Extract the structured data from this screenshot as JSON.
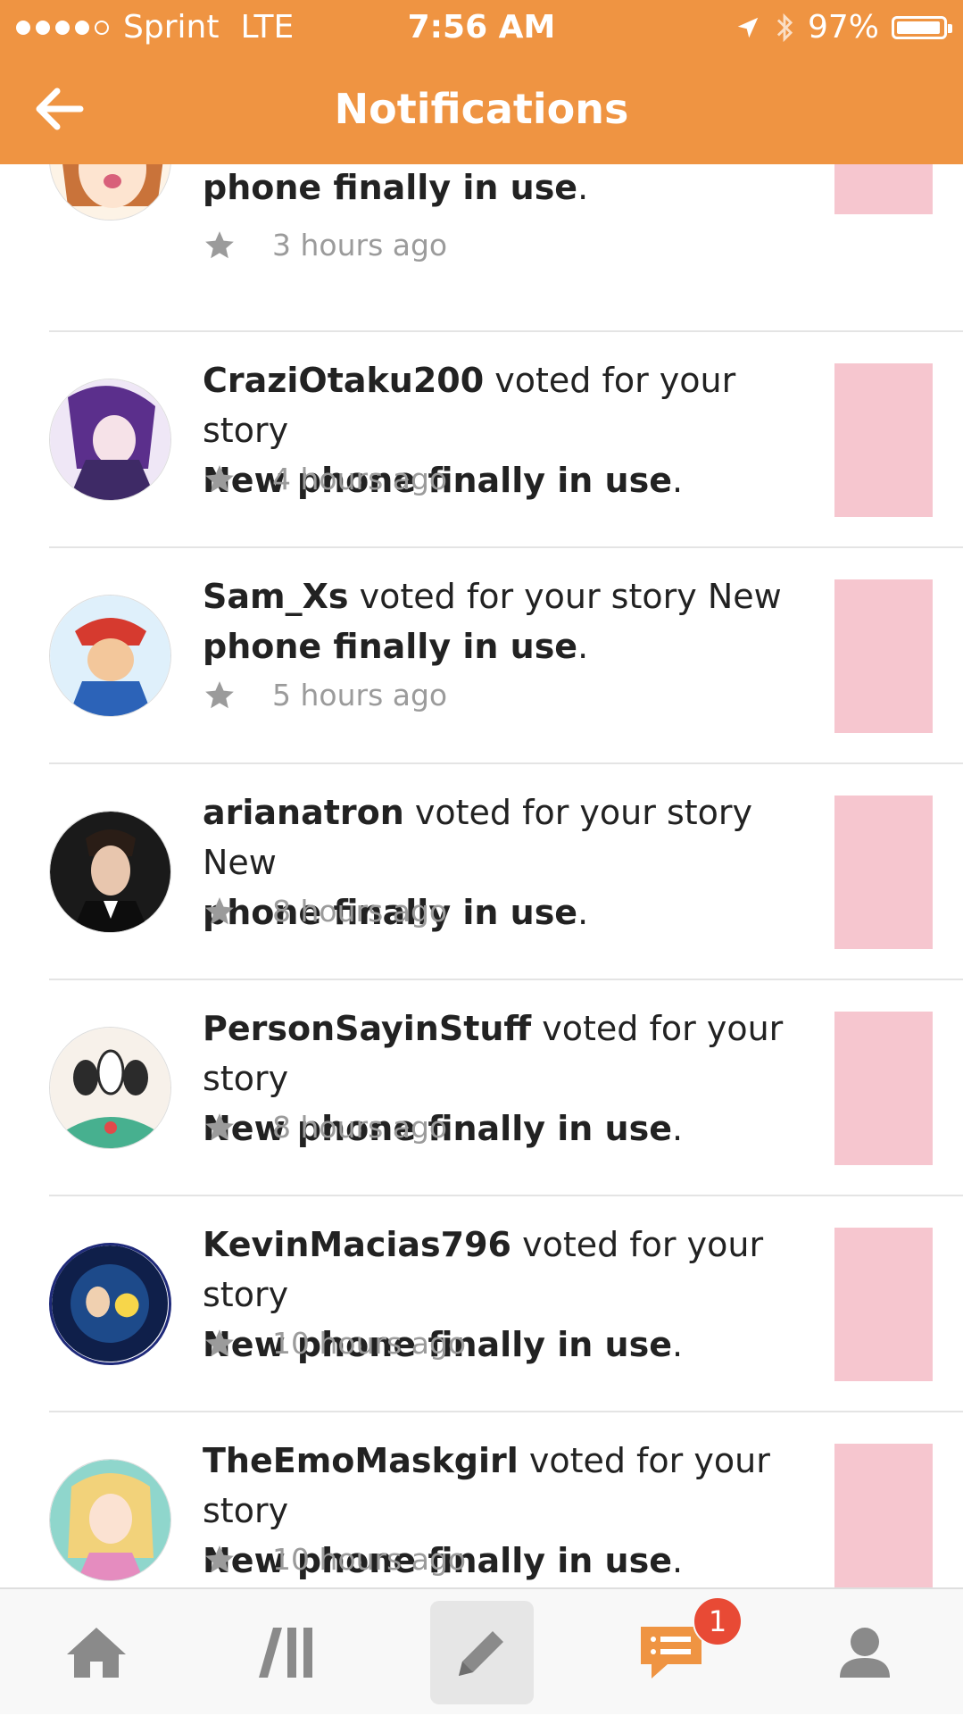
{
  "status_bar": {
    "carrier": "Sprint",
    "network": "LTE",
    "time": "7:56 AM",
    "battery": "97%"
  },
  "header": {
    "title": "Notifications",
    "back_icon": "arrow-left-icon"
  },
  "notifications": [
    {
      "username": "",
      "action": "",
      "story_prefix": "",
      "story_tail": "phone finally in use",
      "period": ".",
      "time": "3 hours ago"
    },
    {
      "username": "CraziOtaku200",
      "action": " voted for your story ",
      "story_prefix": "",
      "story_tail": "New phone finally in use",
      "period": ".",
      "time": "4 hours ago"
    },
    {
      "username": "Sam_Xs",
      "action": " voted for your story ",
      "story_prefix": "",
      "story_tail": "New phone finally in use",
      "period": ".",
      "time": "5 hours ago"
    },
    {
      "username": "arianatron",
      "action": " voted for your story ",
      "story_prefix": "",
      "story_tail": "New phone finally in use",
      "period": ".",
      "time": "8 hours ago"
    },
    {
      "username": "PersonSayinStuff",
      "action": " voted for your story ",
      "story_prefix": "",
      "story_tail": "New phone finally in use",
      "period": ".",
      "time": "8 hours ago"
    },
    {
      "username": "KevinMacias796",
      "action": " voted for your story ",
      "story_prefix": "",
      "story_tail": "New phone finally in use",
      "period": ".",
      "time": "10 hours ago"
    },
    {
      "username": "TheEmoMaskgirl",
      "action": " voted for your story ",
      "story_prefix": "",
      "story_tail": "New phone finally in use",
      "period": ".",
      "time": "10 hours ago"
    }
  ],
  "tab_bar": {
    "items": [
      "home-icon",
      "library-icon",
      "pencil-icon",
      "messages-icon",
      "profile-icon"
    ],
    "messages_badge": "1"
  },
  "colors": {
    "accent": "#ef9442",
    "badge": "#e84a35",
    "icon_gray": "#8a8a8a",
    "star_gray": "#9b9b9b"
  }
}
